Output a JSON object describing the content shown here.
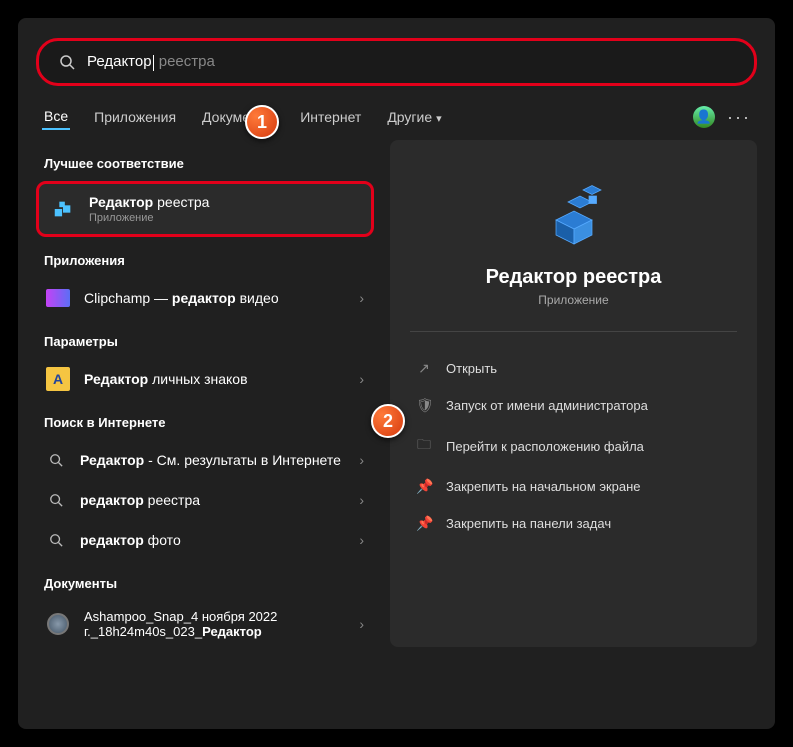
{
  "search": {
    "typed": "Редактор",
    "suggestion": " реестра"
  },
  "callouts": {
    "one": "1",
    "two": "2"
  },
  "tabs": {
    "all": "Все",
    "apps": "Приложения",
    "docs": "Документы",
    "web": "Интернет",
    "more": "Другие"
  },
  "sections": {
    "best": "Лучшее соответствие",
    "apps": "Приложения",
    "settings": "Параметры",
    "web": "Поиск в Интернете",
    "docs": "Документы"
  },
  "results": {
    "best": {
      "title_bold": "Редактор",
      "title_rest": " реестра",
      "sub": "Приложение"
    },
    "app1": {
      "pre": "Clipchamp — ",
      "bold": "редактор",
      "post": " видео"
    },
    "setting1": {
      "bold": "Редактор",
      "post": " личных знаков"
    },
    "web1": {
      "bold": "Редактор",
      "post": " - См. результаты в Интернете"
    },
    "web2": {
      "bold": "редактор",
      "post": " реестра"
    },
    "web3": {
      "bold": "редактор",
      "post": " фото"
    },
    "doc1": {
      "pre": "Ashampoo_Snap_4 ноября 2022 г._18h24m40s_023_",
      "bold": "Редактор"
    }
  },
  "detail": {
    "title": "Редактор реестра",
    "sub": "Приложение",
    "actions": {
      "open": "Открыть",
      "admin": "Запуск от имени администратора",
      "location": "Перейти к расположению файла",
      "pin_start": "Закрепить на начальном экране",
      "pin_taskbar": "Закрепить на панели задач"
    }
  }
}
